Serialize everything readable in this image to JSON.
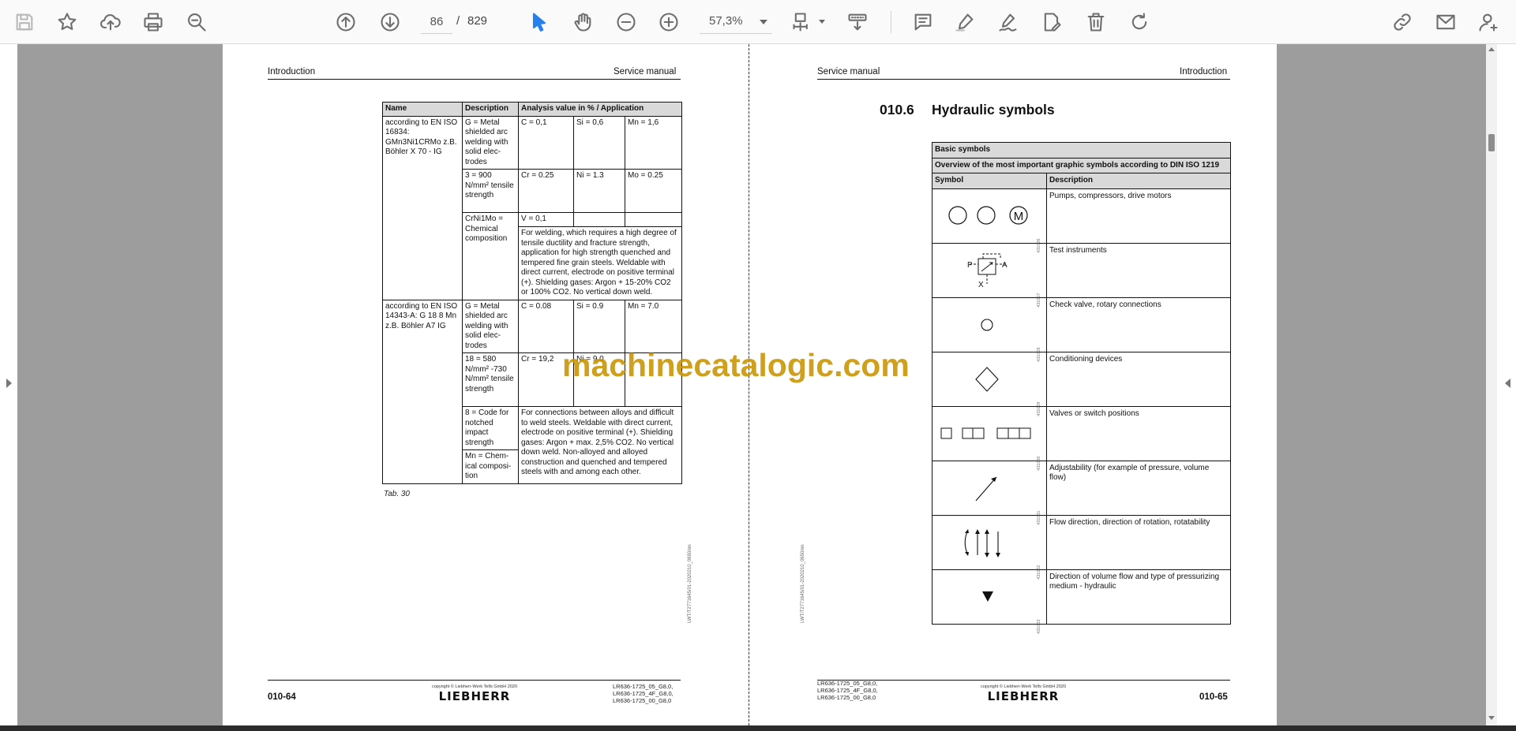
{
  "toolbar": {
    "icons": [
      "save-icon",
      "bookmark-star-icon",
      "upload-icon",
      "print-icon",
      "zoom-search-icon",
      "page-up-icon",
      "page-down-icon",
      "select-cursor-icon",
      "hand-pan-icon",
      "zoom-out-icon",
      "zoom-in-icon",
      "fit-page-icon",
      "scroll-mode-icon",
      "comment-icon",
      "highlight-pen-icon",
      "sign-icon",
      "edit-pdf-icon",
      "delete-icon",
      "rotate-icon",
      "share-link-icon",
      "email-icon",
      "account-icon"
    ],
    "page_current": "86",
    "page_separator": "/",
    "page_total": "829",
    "zoom": "57,3%",
    "accent_color": "#2680eb"
  },
  "left_page": {
    "header_left": "Introduction",
    "header_right": "Service manual",
    "table": {
      "headers": [
        "Name",
        "Description",
        "Analysis value in % / Application"
      ],
      "groupA_name": "according to EN ISO 16834: GMn3Ni1CRMo z.B. Böhler X 70 - IG",
      "groupA_r1_desc": "G = Metal shielded arc welding with solid elec-trodes",
      "groupA_r1_c": "C = 0,1",
      "groupA_r1_si": "Si = 0,6",
      "groupA_r1_mn": "Mn = 1,6",
      "groupA_r2_desc": "3 = 900 N/mm² tensile strength",
      "groupA_r2_cr": "Cr = 0.25",
      "groupA_r2_ni": "Ni = 1.3",
      "groupA_r2_mo": "Mo = 0.25",
      "groupA_r3_desc": "CrNi1Mo = Chemical composition",
      "groupA_r3_v": "V = 0,1",
      "groupA_app": "For welding, which requires a high degree of tensile ductility and fracture strength, application for high strength quenched and tempered fine grain steels. Weldable with direct current, electrode on positive terminal (+). Shielding gases: Argon + 15-20% CO2 or 100% CO2. No vertical down weld.",
      "groupB_name": "according to EN ISO 14343-A: G 18 8 Mn z.B. Böhler A7 IG",
      "groupB_r1_desc": "G = Metal shielded arc welding with solid elec-trodes",
      "groupB_r1_c": "C = 0.08",
      "groupB_r1_si": "Si = 0.9",
      "groupB_r1_mn": "Mn = 7.0",
      "groupB_r2_desc": "18 = 580 N/mm² -730 N/mm² tensile strength",
      "groupB_r2_cr": "Cr = 19,2",
      "groupB_r2_ni": "Ni = 9,0",
      "groupB_r3_desc": "8 = Code for notched impact strength",
      "groupB_r4_desc": "Mn = Chem-ical composi-tion",
      "groupB_app": "For connections between alloys and difficult to weld steels. Weldable with direct current, electrode on positive terminal (+). Shielding gases: Argon + max. 2,5% CO2. No vertical down weld. Non-alloyed and alloyed construction and quenched and tempered steels with and among each other."
    },
    "caption": "Tab. 30",
    "side_id": "LWT/T2771645/01-2020210_0650/en",
    "footer_page": "010-64",
    "footer_copyright": "copyright © Liebherr-Werk Telfs GmbH 2020",
    "footer_logo": "LIEBHERR",
    "footer_models": "LR636-1725_05_G8,0,\nLR636-1725_4F_G8,0,\nLR636-1725_00_G8,0"
  },
  "right_page": {
    "header_left": "Service manual",
    "header_right": "Introduction",
    "section_number": "010.6",
    "section_title": "Hydraulic symbols",
    "table": {
      "title": "Basic symbols",
      "subtitle": "Overview of the most important graphic symbols according to DIN ISO 1219",
      "col_symbol": "Symbol",
      "col_description": "Description",
      "rows": [
        {
          "id": "431026",
          "description": "Pumps, compressors, drive motors",
          "symbol_text": "M"
        },
        {
          "id": "431027",
          "description": "Test instruments",
          "symbol_text_p": "P",
          "symbol_text_a": "A",
          "symbol_text_x": "X"
        },
        {
          "id": "431028",
          "description": "Check valve, rotary connections"
        },
        {
          "id": "431029",
          "description": "Conditioning devices"
        },
        {
          "id": "431030",
          "description": "Valves or switch positions"
        },
        {
          "id": "431031",
          "description": "Adjustability (for example of pressure, volume flow)"
        },
        {
          "id": "431032",
          "description": "Flow direction, direction of rotation, rotatability"
        },
        {
          "id": "431033",
          "description": "Direction of volume flow and type of pressurizing medium - hydraulic"
        }
      ]
    },
    "side_id": "LWT/T2771645/01-2020210_0650/en",
    "footer_page": "010-65",
    "footer_copyright": "copyright © Liebherr-Werk Telfs GmbH 2020",
    "footer_logo": "LIEBHERR",
    "footer_models": "LR636-1725_05_G8,0,\nLR636-1725_4F_G8,0,\nLR636-1725_00_G8,0"
  },
  "watermark": "machinecatalogic.com"
}
